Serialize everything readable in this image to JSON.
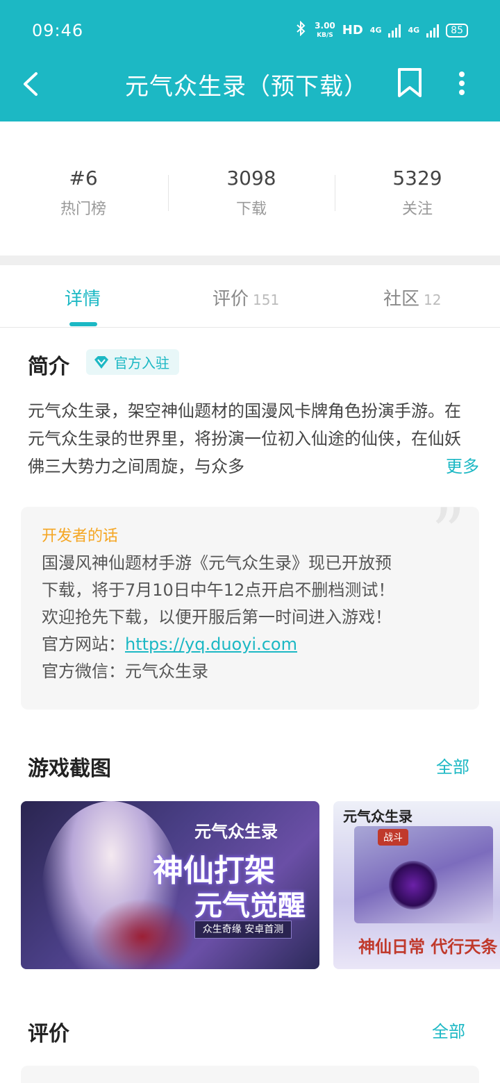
{
  "status_bar": {
    "time": "09:46",
    "speed": "3.00",
    "speed_unit": "KB/S",
    "hd": "HD",
    "net1": "4G",
    "net2": "4G",
    "battery": "85"
  },
  "app_bar": {
    "title": "元气众生录（预下载）",
    "back_icon": "chevron-left-icon",
    "bookmark_icon": "bookmark-icon",
    "more_icon": "more-vertical-icon"
  },
  "stats": [
    {
      "value": "#6",
      "label": "热门榜"
    },
    {
      "value": "3098",
      "label": "下载"
    },
    {
      "value": "5329",
      "label": "关注"
    }
  ],
  "tabs": [
    {
      "label": "详情",
      "count": ""
    },
    {
      "label": "评价",
      "count": "151"
    },
    {
      "label": "社区",
      "count": "12"
    }
  ],
  "intro": {
    "title": "简介",
    "badge": "官方入驻",
    "text": "元气众生录，架空神仙题材的国漫风卡牌角色扮演手游。在元气众生录的世界里，将扮演一位初入仙途的仙侠，在仙妖佛三大势力之间周旋，与众多",
    "more": "更多"
  },
  "developer": {
    "title": "开发者的话",
    "lines": [
      "国漫风神仙题材手游《元气众生录》现已开放预",
      "下载，将于7月10日中午12点开启不删档测试！",
      "欢迎抢先下载，以便开服后第一时间进入游戏！"
    ],
    "site_label": "官方网站：",
    "site_url": "https://yq.duoyi.com",
    "wechat": "官方微信：元气众生录"
  },
  "screenshots": {
    "title": "游戏截图",
    "see_all": "全部",
    "shot1_logo": "元气众生录",
    "shot1_line1": "神仙打架",
    "shot1_line2": "元气觉醒",
    "shot1_sub": "众生奇缘 安卓首测",
    "shot2_logo": "元气众生录",
    "shot2_badge": "战斗",
    "shot2_slogan": "神仙日常 代行天条"
  },
  "reviews": {
    "title": "评价",
    "see_all": "全部"
  },
  "colors": {
    "accent": "#1cb8c4",
    "developer_title": "#f5a623"
  }
}
